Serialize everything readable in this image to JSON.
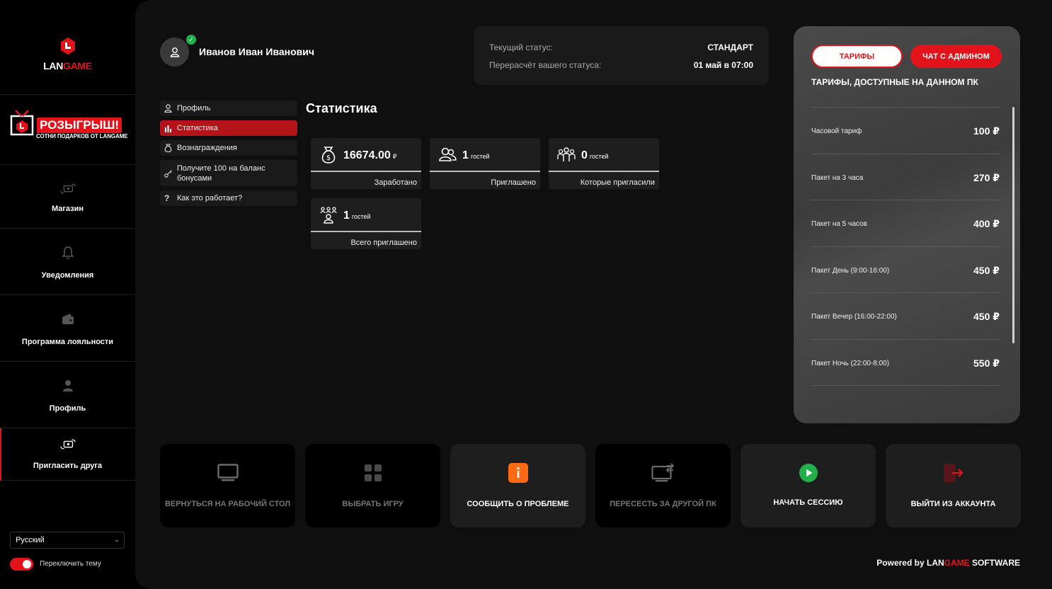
{
  "brand": {
    "logo_left": "LAN",
    "logo_right": "GAME",
    "accent": "#e3131b"
  },
  "promo": {
    "title": "РОЗЫГРЫШ!",
    "subtitle": "СОТНИ ПОДАРКОВ ОТ LANGAME"
  },
  "sidebar": {
    "items": [
      {
        "label": "Магазин",
        "icon": "cash-transfer-icon"
      },
      {
        "label": "Уведомления",
        "icon": "bell-icon"
      },
      {
        "label": "Программа лояльности",
        "icon": "wallet-icon"
      },
      {
        "label": "Профиль",
        "icon": "user-icon"
      },
      {
        "label": "Пригласить друга",
        "icon": "cash-transfer-icon",
        "active": true
      }
    ],
    "language": "Русский",
    "theme_toggle_label": "Переключить тему"
  },
  "user": {
    "name": "Иванов Иван Иванович"
  },
  "status": {
    "current_label": "Текущий статус:",
    "current_value": "СТАНДАРТ",
    "recalc_label": "Перерасчёт вашего статуса:",
    "recalc_value": "01 май в 07:00"
  },
  "profile_menu": [
    {
      "label": "Профиль",
      "icon": "user-icon"
    },
    {
      "label": "Статистика",
      "icon": "bar-chart-icon",
      "active": true
    },
    {
      "label": "Вознаграждения",
      "icon": "money-bag-icon"
    },
    {
      "label": "Получите 100 на баланс бонусами",
      "icon": "key-icon"
    },
    {
      "label": "Как это работает?",
      "icon": "question-icon"
    }
  ],
  "stats": {
    "title": "Статистика",
    "cards": [
      {
        "value": "16674.00",
        "unit": "₽",
        "caption": "Заработано",
        "icon": "money-bag-icon"
      },
      {
        "value": "1",
        "unit": "гостей",
        "caption": "Приглашено",
        "icon": "users-icon"
      },
      {
        "value": "0",
        "unit": "гостей",
        "caption": "Которые пригласили",
        "icon": "group-icon"
      },
      {
        "value": "1",
        "unit": "гостей",
        "caption": "Всего приглашено",
        "icon": "network-icon"
      }
    ]
  },
  "tariffs": {
    "tab_label": "ТАРИФЫ",
    "chat_label": "ЧАТ С АДМИНОМ",
    "title": "ТАРИФЫ, ДОСТУПНЫЕ НА ДАННОМ ПК",
    "items": [
      {
        "name": "Часовой тариф",
        "price": "100 ₽"
      },
      {
        "name": "Пакет на 3 часа",
        "price": "270 ₽"
      },
      {
        "name": "Пакет на 5 часов",
        "price": "400 ₽"
      },
      {
        "name": "Пакет День (9:00-16:00)",
        "price": "450 ₽"
      },
      {
        "name": "Пакет Вечер (16:00-22:00)",
        "price": "450 ₽"
      },
      {
        "name": "Пакет Ночь (22:00-8:00)",
        "price": "550 ₽"
      }
    ]
  },
  "actions": [
    {
      "label": "ВЕРНУТЬСЯ НА РАБОЧИЙ СТОЛ",
      "icon": "monitor-icon"
    },
    {
      "label": "ВЫБРАТЬ ИГРУ",
      "icon": "grid-icon"
    },
    {
      "label": "СООБЩИТЬ О ПРОБЛЕМЕ",
      "icon": "info-icon",
      "color": "#ff6a13"
    },
    {
      "label": "ПЕРЕСЕСТЬ ЗА ДРУГОЙ ПК",
      "icon": "monitor-swap-icon"
    },
    {
      "label": "НАЧАТЬ СЕССИЮ",
      "icon": "play-icon",
      "color": "#22b04b"
    },
    {
      "label": "ВЫЙТИ ИЗ АККАУНТА",
      "icon": "logout-icon",
      "color": "#e3131b"
    }
  ],
  "footer": {
    "powered_prefix": "Powered by",
    "powered_lan": "LAN",
    "powered_game": "GAME",
    "powered_suffix": "SOFTWARE"
  }
}
